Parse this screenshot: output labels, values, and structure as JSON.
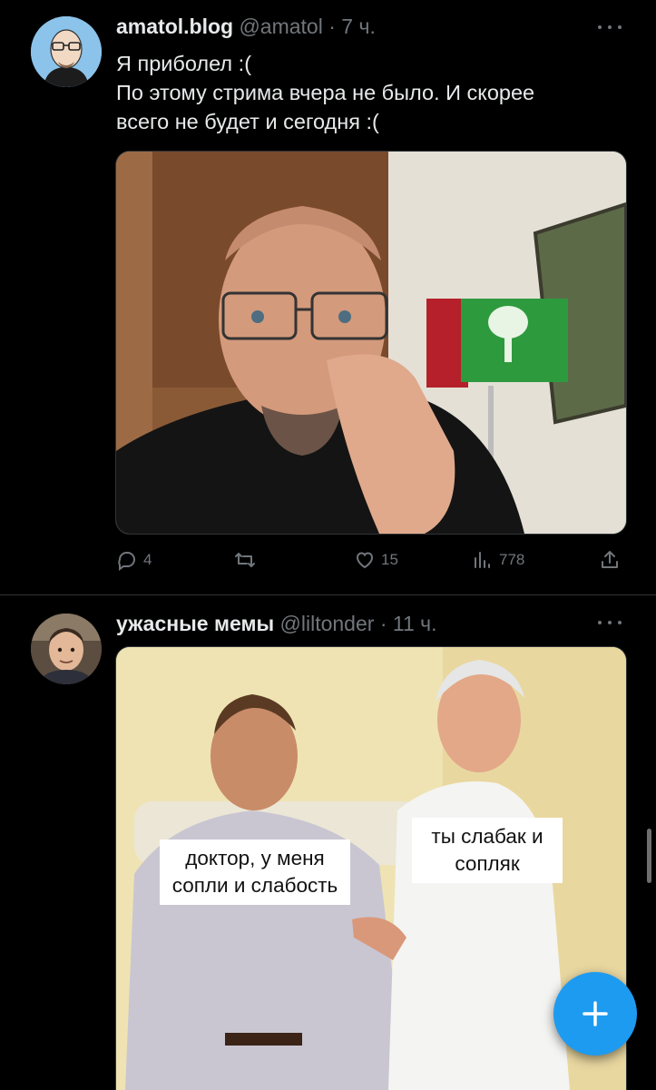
{
  "tweets": [
    {
      "display_name": "amatol.blog",
      "handle": "@amatol",
      "separator": "·",
      "time": "7 ч.",
      "text_lines": [
        "Я приболел :(",
        "По этому стрима вчера не было. И скорее",
        "всего не будет и сегодня :("
      ],
      "media_icon": "selfie-photo",
      "stats": {
        "replies": "4",
        "retweets": "",
        "likes": "15",
        "views": "778"
      }
    },
    {
      "display_name": "ужасные мемы",
      "handle": "@liltonder",
      "separator": "·",
      "time": "11 ч.",
      "meme": {
        "left_caption": "доктор, у меня сопли и слабость",
        "right_caption": "ты слабак и сопляк"
      }
    }
  ],
  "icons": {
    "reply": "reply-icon",
    "retweet": "retweet-icon",
    "like": "heart-icon",
    "views": "views-icon",
    "share": "share-icon",
    "compose": "plus-icon",
    "more": "more-icon"
  },
  "colors": {
    "accent": "#1d9bf0",
    "muted": "#71767b",
    "divider": "#2f3336",
    "background": "#000000"
  }
}
